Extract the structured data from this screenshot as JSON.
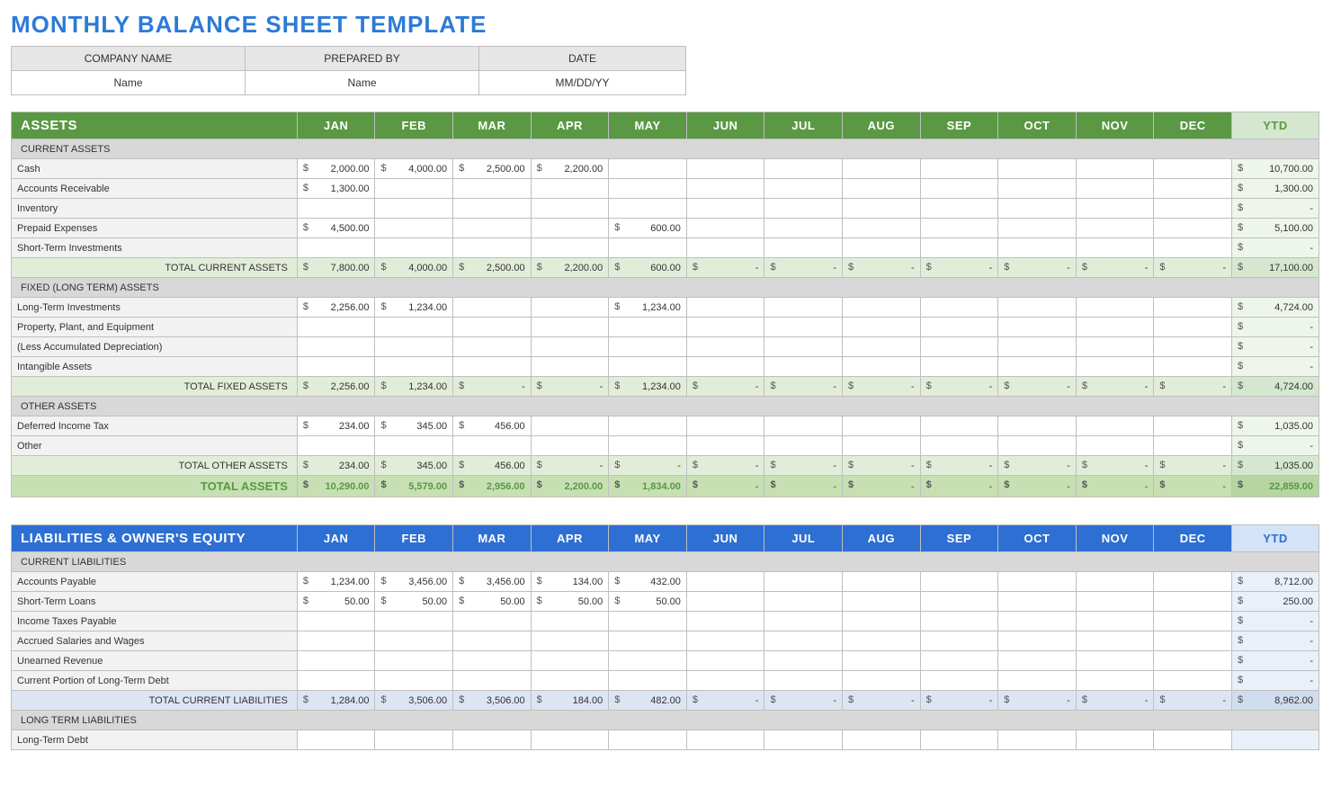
{
  "title": "MONTHLY BALANCE SHEET TEMPLATE",
  "info": {
    "headers": [
      "COMPANY NAME",
      "PREPARED BY",
      "DATE"
    ],
    "values": [
      "Name",
      "Name",
      "MM/DD/YY"
    ]
  },
  "months": [
    "JAN",
    "FEB",
    "MAR",
    "APR",
    "MAY",
    "JUN",
    "JUL",
    "AUG",
    "SEP",
    "OCT",
    "NOV",
    "DEC"
  ],
  "ytd_label": "YTD",
  "assets": {
    "title": "ASSETS",
    "sections": [
      {
        "name": "CURRENT ASSETS",
        "rows": [
          {
            "label": "Cash",
            "v": [
              "2,000.00",
              "4,000.00",
              "2,500.00",
              "2,200.00",
              "",
              "",
              "",
              "",
              "",
              "",
              "",
              ""
            ],
            "ytd": "10,700.00"
          },
          {
            "label": "Accounts Receivable",
            "v": [
              "1,300.00",
              "",
              "",
              "",
              "",
              "",
              "",
              "",
              "",
              "",
              "",
              ""
            ],
            "ytd": "1,300.00"
          },
          {
            "label": "Inventory",
            "v": [
              "",
              "",
              "",
              "",
              "",
              "",
              "",
              "",
              "",
              "",
              "",
              ""
            ],
            "ytd": "-"
          },
          {
            "label": "Prepaid Expenses",
            "v": [
              "4,500.00",
              "",
              "",
              "",
              "600.00",
              "",
              "",
              "",
              "",
              "",
              "",
              ""
            ],
            "ytd": "5,100.00"
          },
          {
            "label": "Short-Term Investments",
            "v": [
              "",
              "",
              "",
              "",
              "",
              "",
              "",
              "",
              "",
              "",
              "",
              ""
            ],
            "ytd": "-"
          }
        ],
        "subtotal": {
          "label": "TOTAL CURRENT ASSETS",
          "v": [
            "7,800.00",
            "4,000.00",
            "2,500.00",
            "2,200.00",
            "600.00",
            "-",
            "-",
            "-",
            "-",
            "-",
            "-",
            "-"
          ],
          "ytd": "17,100.00"
        }
      },
      {
        "name": "FIXED (LONG TERM) ASSETS",
        "rows": [
          {
            "label": "Long-Term Investments",
            "v": [
              "2,256.00",
              "1,234.00",
              "",
              "",
              "1,234.00",
              "",
              "",
              "",
              "",
              "",
              "",
              ""
            ],
            "ytd": "4,724.00"
          },
          {
            "label": "Property, Plant, and Equipment",
            "v": [
              "",
              "",
              "",
              "",
              "",
              "",
              "",
              "",
              "",
              "",
              "",
              ""
            ],
            "ytd": "-"
          },
          {
            "label": "(Less Accumulated Depreciation)",
            "v": [
              "",
              "",
              "",
              "",
              "",
              "",
              "",
              "",
              "",
              "",
              "",
              ""
            ],
            "ytd": "-"
          },
          {
            "label": "Intangible Assets",
            "v": [
              "",
              "",
              "",
              "",
              "",
              "",
              "",
              "",
              "",
              "",
              "",
              ""
            ],
            "ytd": "-"
          }
        ],
        "subtotal": {
          "label": "TOTAL FIXED ASSETS",
          "v": [
            "2,256.00",
            "1,234.00",
            "-",
            "-",
            "1,234.00",
            "-",
            "-",
            "-",
            "-",
            "-",
            "-",
            "-"
          ],
          "ytd": "4,724.00"
        }
      },
      {
        "name": "OTHER ASSETS",
        "rows": [
          {
            "label": "Deferred Income Tax",
            "v": [
              "234.00",
              "345.00",
              "456.00",
              "",
              "",
              "",
              "",
              "",
              "",
              "",
              "",
              ""
            ],
            "ytd": "1,035.00"
          },
          {
            "label": "Other",
            "v": [
              "",
              "",
              "",
              "",
              "",
              "",
              "",
              "",
              "",
              "",
              "",
              ""
            ],
            "ytd": "-"
          }
        ],
        "subtotal": {
          "label": "TOTAL OTHER ASSETS",
          "v": [
            "234.00",
            "345.00",
            "456.00",
            "-",
            "-",
            "-",
            "-",
            "-",
            "-",
            "-",
            "-",
            "-"
          ],
          "ytd": "1,035.00"
        }
      }
    ],
    "grand": {
      "label": "TOTAL ASSETS",
      "v": [
        "10,290.00",
        "5,579.00",
        "2,956.00",
        "2,200.00",
        "1,834.00",
        "-",
        "-",
        "-",
        "-",
        "-",
        "-",
        "-"
      ],
      "ytd": "22,859.00"
    }
  },
  "liab": {
    "title": "LIABILITIES & OWNER'S EQUITY",
    "sections": [
      {
        "name": "CURRENT LIABILITIES",
        "rows": [
          {
            "label": "Accounts Payable",
            "v": [
              "1,234.00",
              "3,456.00",
              "3,456.00",
              "134.00",
              "432.00",
              "",
              "",
              "",
              "",
              "",
              "",
              ""
            ],
            "ytd": "8,712.00"
          },
          {
            "label": "Short-Term Loans",
            "v": [
              "50.00",
              "50.00",
              "50.00",
              "50.00",
              "50.00",
              "",
              "",
              "",
              "",
              "",
              "",
              ""
            ],
            "ytd": "250.00"
          },
          {
            "label": "Income Taxes Payable",
            "v": [
              "",
              "",
              "",
              "",
              "",
              "",
              "",
              "",
              "",
              "",
              "",
              ""
            ],
            "ytd": "-"
          },
          {
            "label": "Accrued Salaries and Wages",
            "v": [
              "",
              "",
              "",
              "",
              "",
              "",
              "",
              "",
              "",
              "",
              "",
              ""
            ],
            "ytd": "-"
          },
          {
            "label": "Unearned Revenue",
            "v": [
              "",
              "",
              "",
              "",
              "",
              "",
              "",
              "",
              "",
              "",
              "",
              ""
            ],
            "ytd": "-"
          },
          {
            "label": "Current Portion of Long-Term Debt",
            "v": [
              "",
              "",
              "",
              "",
              "",
              "",
              "",
              "",
              "",
              "",
              "",
              ""
            ],
            "ytd": "-"
          }
        ],
        "subtotal": {
          "label": "TOTAL CURRENT LIABILITIES",
          "v": [
            "1,284.00",
            "3,506.00",
            "3,506.00",
            "184.00",
            "482.00",
            "-",
            "-",
            "-",
            "-",
            "-",
            "-",
            "-"
          ],
          "ytd": "8,962.00"
        }
      },
      {
        "name": "LONG TERM LIABILITIES",
        "rows": [
          {
            "label": "Long-Term Debt",
            "v": [
              "",
              "",
              "",
              "",
              "",
              "",
              "",
              "",
              "",
              "",
              "",
              ""
            ],
            "ytd": ""
          }
        ]
      }
    ]
  }
}
